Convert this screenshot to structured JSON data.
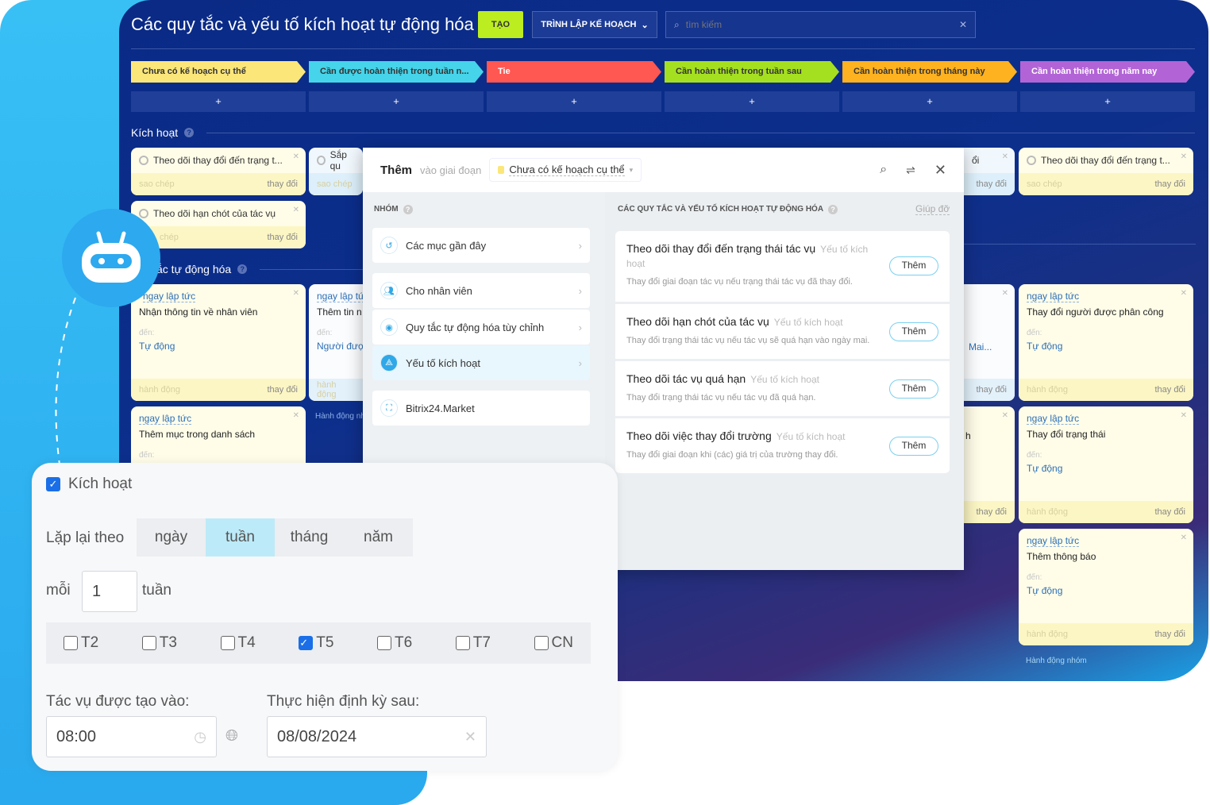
{
  "colors": {
    "accent": "#bbed21",
    "board": "#0c2f8c",
    "cyan": "#38c0f5"
  },
  "header": {
    "title": "Các quy tắc và yếu tố kích hoạt tự động hóa",
    "create": "TẠO",
    "planner": "TRÌNH LẬP KẾ HOẠCH",
    "search_placeholder": "tìm kiếm"
  },
  "columns": [
    {
      "label": "Chưa có kế hoạch cụ thể",
      "color": "#fbe67a"
    },
    {
      "label": "Cần được hoàn thiện trong tuần n...",
      "color": "#45d4ea"
    },
    {
      "label": "Tie",
      "color": "#ff5752"
    },
    {
      "label": "Cần hoàn thiện trong tuần sau",
      "color": "#a5e020"
    },
    {
      "label": "Cần hoàn thiện trong tháng này",
      "color": "#ffb21f"
    },
    {
      "label": "Cần hoàn thiện trong năm nay",
      "color": "#b264d6"
    }
  ],
  "plus": "+",
  "triggers_section": "Kích hoạt",
  "rules_section": "ắc tự động hóa",
  "triggers": {
    "c1a": "Theo dõi thay đổi đến trạng t...",
    "c1b": "Theo dõi hạn chót của tác vụ",
    "c2a": "Sắp qu",
    "c5": "ổi",
    "c6": "Theo dõi thay đổi đến trạng t...",
    "copy": "sao chép",
    "copy_cut": "chép",
    "change": "thay đổi"
  },
  "rules": {
    "imm": "ngay lập tức",
    "imm_cut": "ngay lập tứ",
    "to": "đến:",
    "auto": "Tự động",
    "action": "hành động",
    "change": "thay đổi",
    "r1": "Nhận thông tin về nhân viên",
    "r2": "Thêm mục trong danh sách",
    "r3": "Thêm tin n",
    "r3to": "Người đượ",
    "group_action_cut": "Hành động nh",
    "r5": "Mai...",
    "r5b": "h",
    "r6": "Thay đổi người được phân công",
    "r7": "Thay đổi trạng thái",
    "r8": "Thêm thông báo",
    "group_action": "Hành động nhóm"
  },
  "modal": {
    "add": "Thêm",
    "to_stage": "vào giai đoạn",
    "stage": "Chưa có kế hoạch cụ thể",
    "groups_title": "NHÓM",
    "rules_title": "CÁC QUY TẮC VÀ YẾU TỐ KÍCH HOẠT TỰ ĐỘNG HÓA",
    "help": "Giúp đỡ",
    "groups": [
      "Các mục gần đây",
      "Cho nhân viên",
      "Quy tắc tự động hóa tùy chỉnh",
      "Yếu tố kích hoạt",
      "Bitrix24.Market"
    ],
    "selected_group": "Yếu tố kích hoạt",
    "items": [
      {
        "title": "Theo dõi thay đổi đến trạng thái tác vụ",
        "kind": "Yếu tố kích hoạt",
        "desc": "Thay đổi giai đoạn tác vụ nếu trạng thái tác vụ đã thay đổi.",
        "btn": "Thêm"
      },
      {
        "title": "Theo dõi hạn chót của tác vụ",
        "kind": "Yếu tố kích hoạt",
        "desc": "Thay đổi trạng thái tác vụ nếu tác vụ sẽ quá hạn vào ngày mai.",
        "btn": "Thêm"
      },
      {
        "title": "Theo dõi tác vụ quá hạn",
        "kind": "Yếu tố kích hoạt",
        "desc": "Thay đổi trạng thái tác vụ nếu tác vụ đã quá hạn.",
        "btn": "Thêm"
      },
      {
        "title": "Theo dõi việc thay đổi trường",
        "kind": "Yếu tố kích hoạt",
        "desc": "Thay đổi giai đoạn khi (các) giá trị của trường thay đổi.",
        "btn": "Thêm"
      }
    ]
  },
  "repeat": {
    "enabled_label": "Kích hoạt",
    "enabled": true,
    "repeat_by": "Lặp lại theo",
    "periods": [
      "ngày",
      "tuần",
      "tháng",
      "năm"
    ],
    "selected_period": "tuần",
    "every": "mỗi",
    "every_value": "1",
    "unit": "tuần",
    "days": [
      {
        "l": "T2",
        "c": false
      },
      {
        "l": "T3",
        "c": false
      },
      {
        "l": "T4",
        "c": false
      },
      {
        "l": "T5",
        "c": true
      },
      {
        "l": "T6",
        "c": false
      },
      {
        "l": "T7",
        "c": false
      },
      {
        "l": "CN",
        "c": false
      }
    ],
    "created_at_label": "Tác vụ được tạo vào:",
    "created_at": "08:00",
    "next_label": "Thực hiện định kỳ sau:",
    "next": "08/08/2024"
  }
}
